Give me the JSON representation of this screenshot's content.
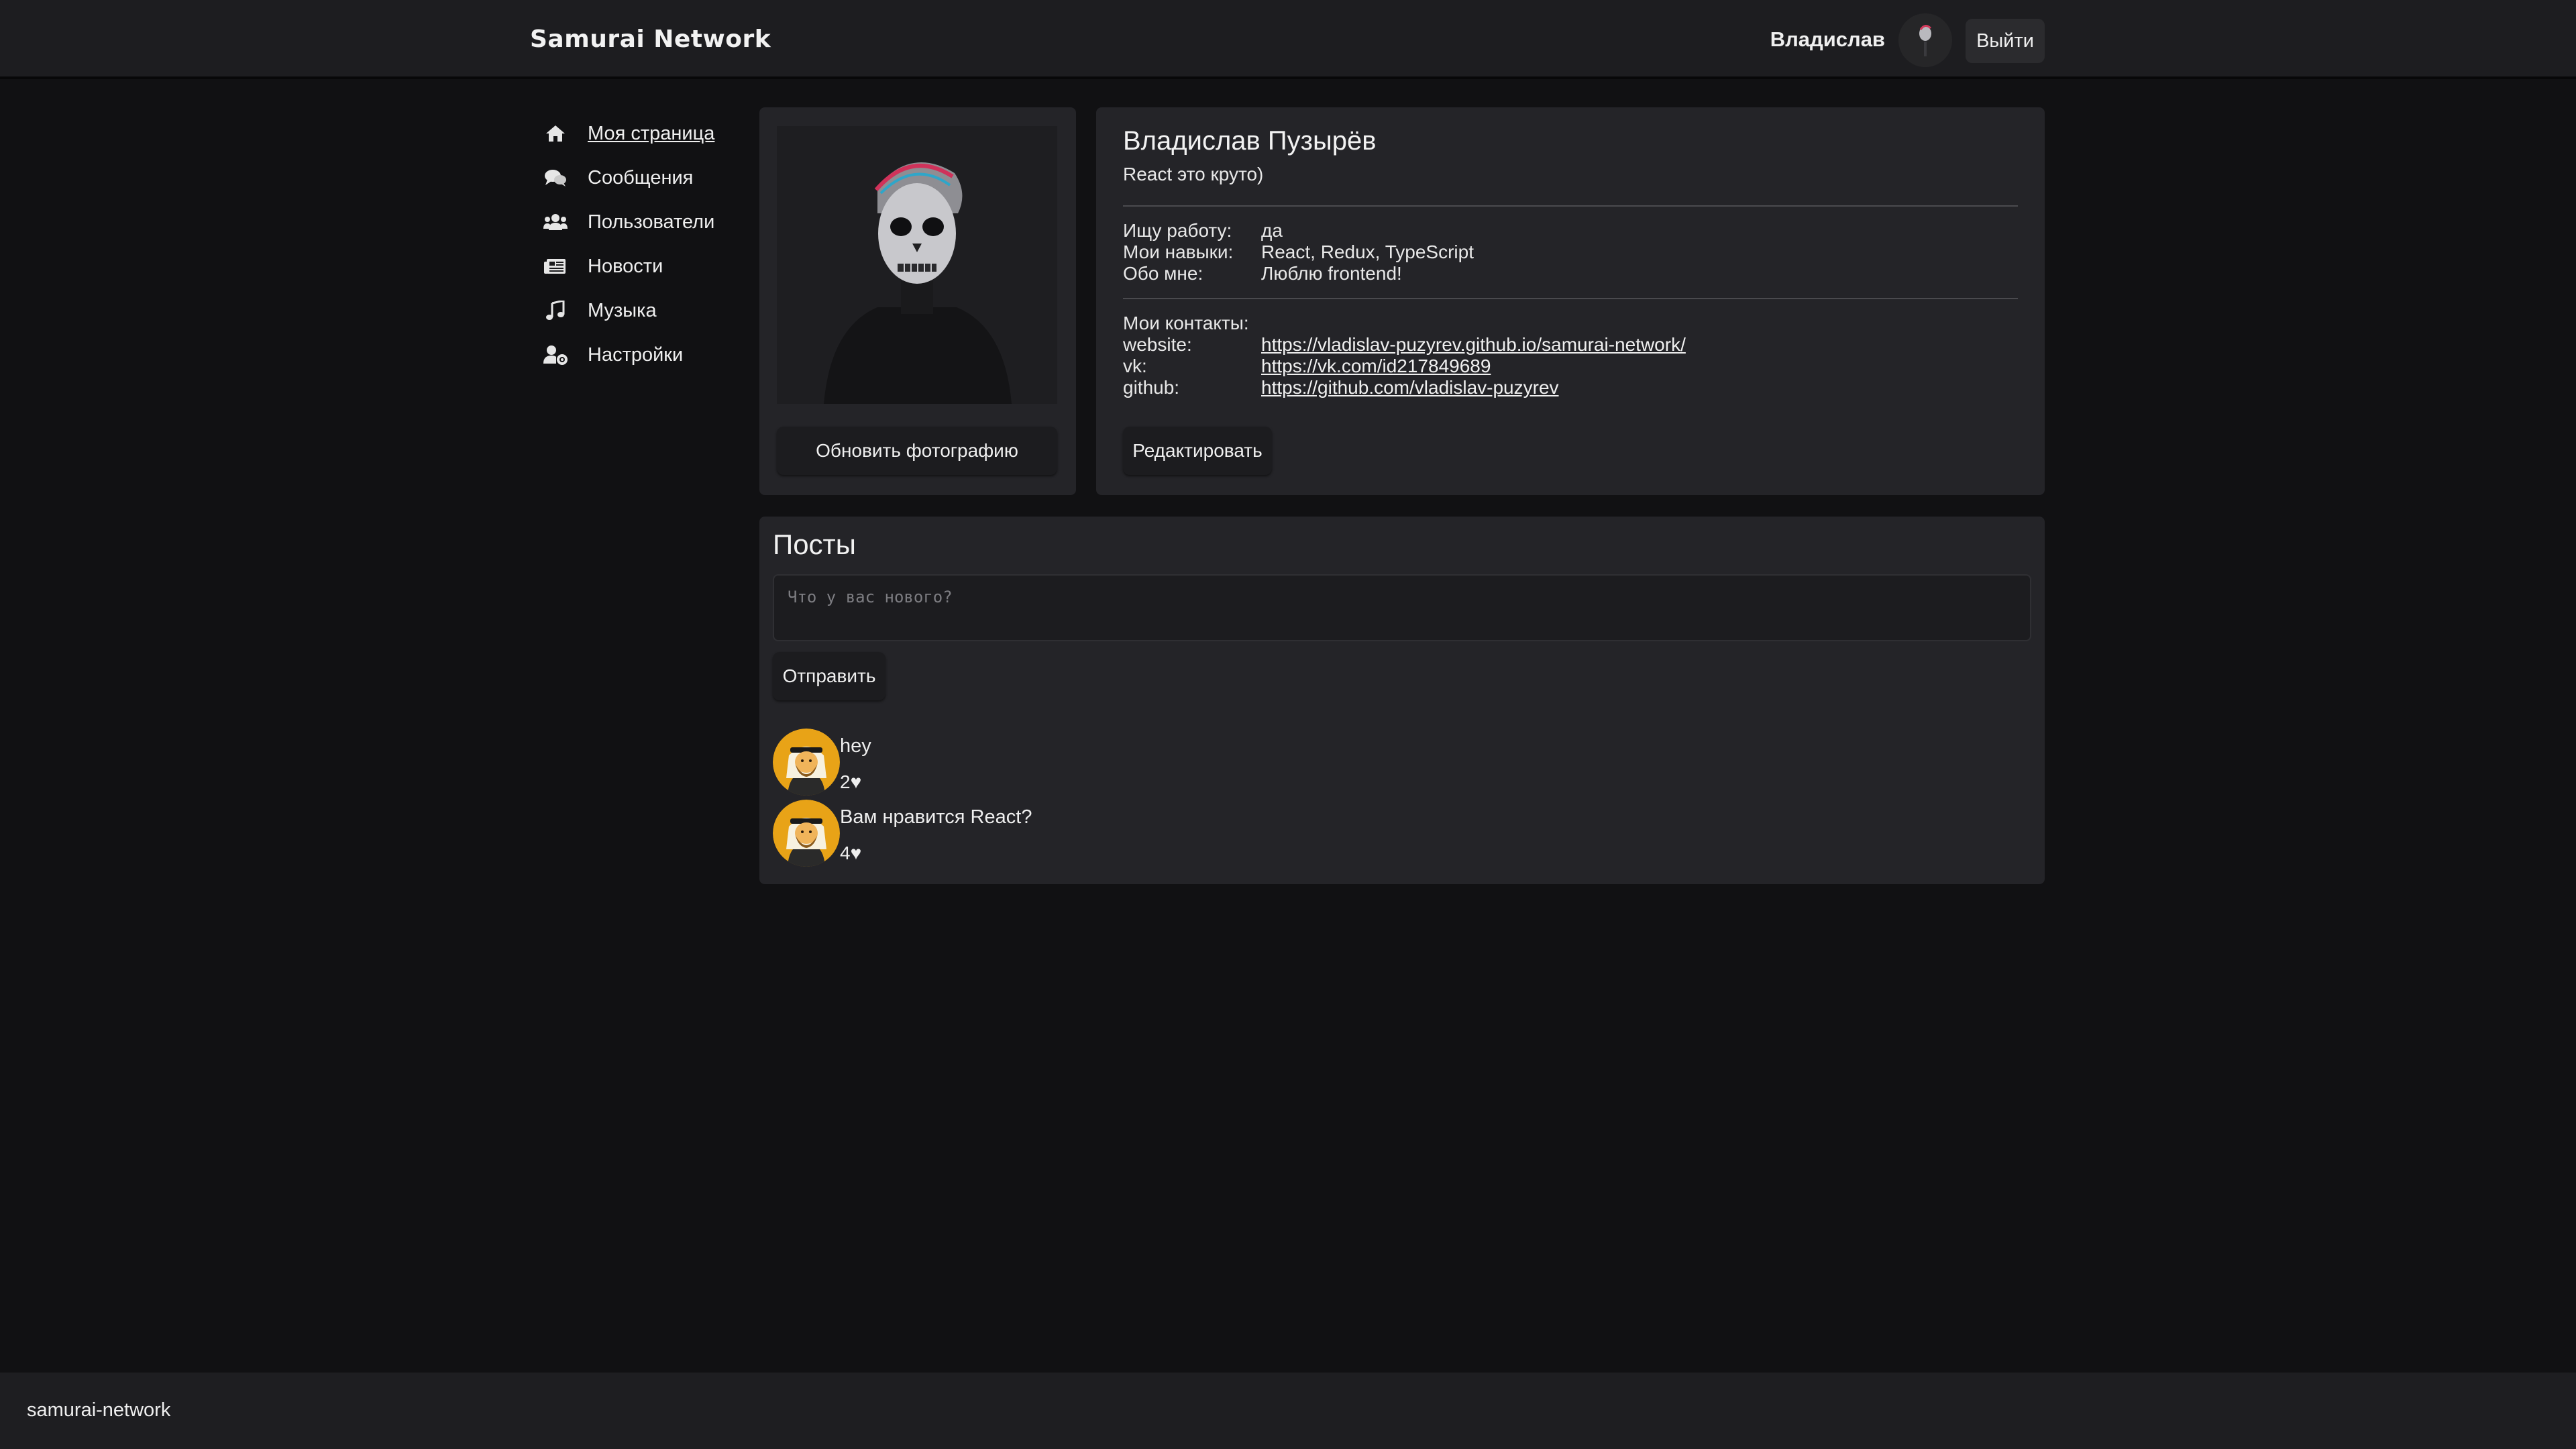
{
  "header": {
    "logo": "Samurai Network",
    "user_name": "Владислав",
    "logout_label": "Выйти"
  },
  "sidebar": {
    "items": [
      {
        "label": "Моя страница",
        "icon": "home-icon"
      },
      {
        "label": "Сообщения",
        "icon": "comments-icon"
      },
      {
        "label": "Пользователи",
        "icon": "users-icon"
      },
      {
        "label": "Новости",
        "icon": "newspaper-icon"
      },
      {
        "label": "Музыка",
        "icon": "music-icon"
      },
      {
        "label": "Настройки",
        "icon": "user-cog-icon"
      }
    ]
  },
  "profile": {
    "update_photo_label": "Обновить фотографию",
    "name": "Владислав Пузырёв",
    "status": "React это круто)",
    "job_key": "Ищу работу:",
    "job_value": "да",
    "skills_key": "Мои навыки:",
    "skills_value": "React, Redux, TypeScript",
    "about_key": "Обо мне:",
    "about_value": "Люблю frontend!",
    "contacts_title": "Мои контакты:",
    "contacts": [
      {
        "key": "website:",
        "value": "https://vladislav-puzyrev.github.io/samurai-network/"
      },
      {
        "key": "vk:",
        "value": "https://vk.com/id217849689"
      },
      {
        "key": "github:",
        "value": "https://github.com/vladislav-puzyrev"
      }
    ],
    "edit_label": "Редактировать"
  },
  "posts": {
    "title": "Посты",
    "placeholder": "Что у вас нового?",
    "send_label": "Отправить",
    "items": [
      {
        "text": "hey",
        "likes": "2♥"
      },
      {
        "text": "Вам нравится React?",
        "likes": "4♥"
      }
    ]
  },
  "footer": {
    "text": "samurai-network"
  },
  "colors": {
    "background": "#111113",
    "card": "#242428",
    "header": "#1d1d20",
    "avatar_gold": "#e8a317"
  }
}
